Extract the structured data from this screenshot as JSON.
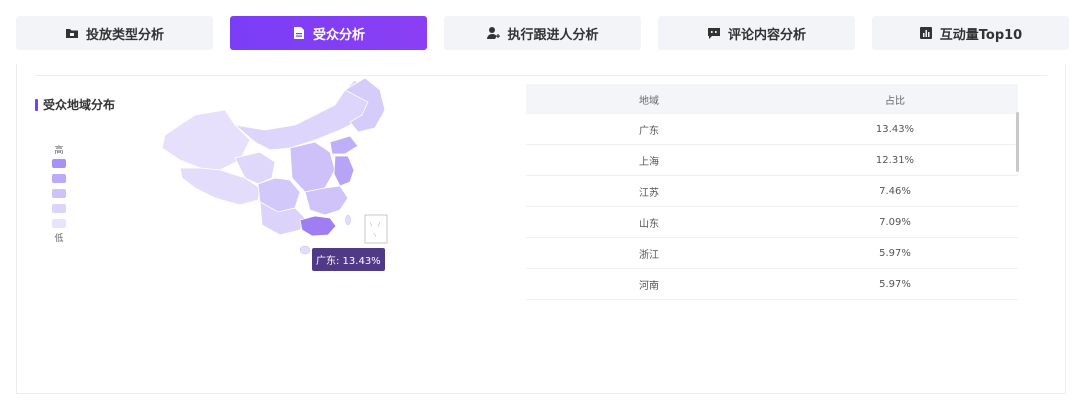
{
  "tabs": [
    {
      "label": "投放类型分析",
      "icon": "folder-icon",
      "active": false
    },
    {
      "label": "受众分析",
      "icon": "document-icon",
      "active": true
    },
    {
      "label": "执行跟进人分析",
      "icon": "user-add-icon",
      "active": false
    },
    {
      "label": "评论内容分析",
      "icon": "comment-icon",
      "active": false
    },
    {
      "label": "互动量Top10",
      "icon": "bar-chart-icon",
      "active": false
    }
  ],
  "section": {
    "title": "受众地域分布"
  },
  "legend": {
    "high": "高",
    "low": "低",
    "colors": [
      "#a990f6",
      "#bbaaf7",
      "#cdc2fa",
      "#dcd4fb",
      "#e9e4fd"
    ]
  },
  "map": {
    "highlight_color": "#9f7df3",
    "base_color": "#e3dcfb",
    "tooltip": "广东: 13.43%"
  },
  "table": {
    "headers": [
      "地域",
      "占比"
    ],
    "rows": [
      [
        "广东",
        "13.43%"
      ],
      [
        "上海",
        "12.31%"
      ],
      [
        "江苏",
        "7.46%"
      ],
      [
        "山东",
        "7.09%"
      ],
      [
        "浙江",
        "5.97%"
      ],
      [
        "河南",
        "5.97%"
      ]
    ]
  }
}
